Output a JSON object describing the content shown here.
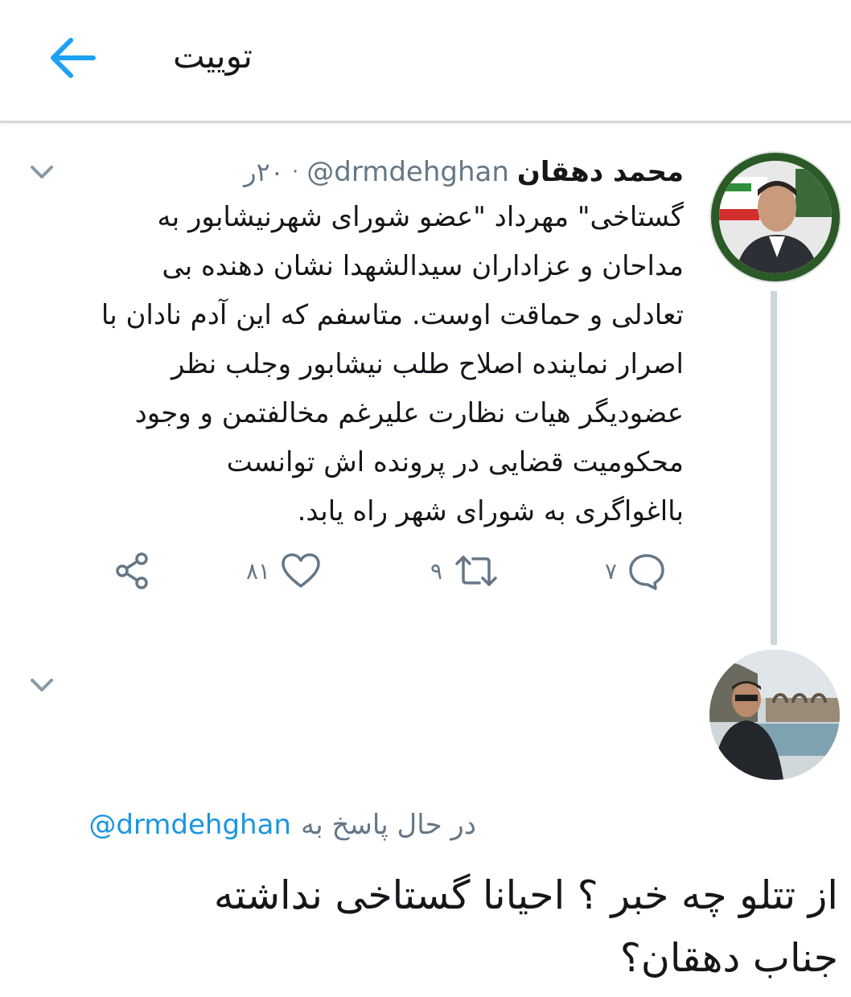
{
  "header": {
    "title": "توییت",
    "back_icon": "arrow-left-icon",
    "accent_color": "#1da1f2"
  },
  "tweet": {
    "author_name": "محمد دهقان",
    "handle": "@drmdehghan",
    "separator": "·",
    "time_ago": "۲۰ر",
    "body_lines": [
      "گستاخی\" مهرداد \"عضو شورای شهرنیشابور به",
      "مداحان و عزاداران سیدالشهدا نشان دهنده بی",
      "تعادلی و حماقت اوست. متاسفم که این آدم نادان با",
      "اصرار نماینده اصلاح طلب نیشابور وجلب نظر",
      "عضودیگر هیات نظارت علیرغم مخالفتمن و وجود",
      "محکومیت قضایی در پرونده اش توانست",
      "بااغواگری به شورای شهر راه یابد."
    ],
    "actions": {
      "reply_count": "۷",
      "retweet_count": "۹",
      "like_count": "۸۱"
    }
  },
  "reply": {
    "replying_to_label": "در حال پاسخ به",
    "replying_to_handle": "@drmdehghan",
    "text_lines": [
      "از تتلو چه خبر ؟ احیانا گستاخی نداشته",
      "جناب دهقان؟"
    ]
  }
}
